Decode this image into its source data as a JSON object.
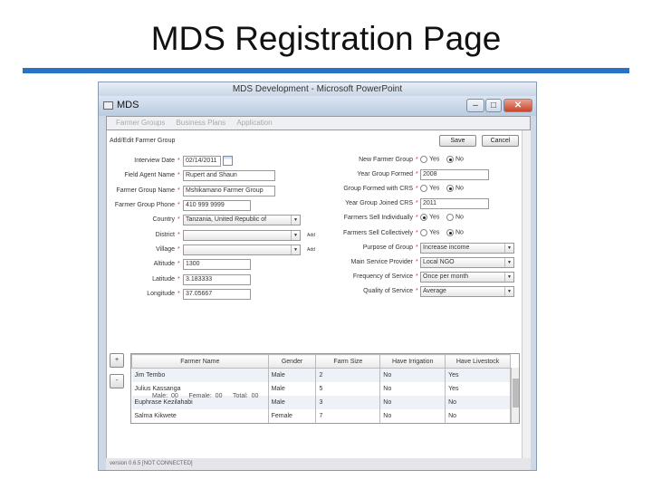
{
  "slide_title": "MDS Registration Page",
  "ppt_title": "MDS Development - Microsoft PowerPoint",
  "app": {
    "title": "MDS",
    "menu": [
      "Farmer Groups",
      "Business Plans",
      "Application"
    ],
    "section": "Add/Edit Farmer Group",
    "save": "Save",
    "cancel": "Cancel",
    "status": "version 0.6.5 [NOT CONNECTED]"
  },
  "left_fields": [
    {
      "label": "Interview Date",
      "value": "02/14/2011",
      "type": "date"
    },
    {
      "label": "Field Agent Name",
      "value": "Rupert and Shaun",
      "type": "text"
    },
    {
      "label": "Farmer Group Name",
      "value": "Mshikamano Farmer Group",
      "type": "text"
    },
    {
      "label": "Farmer Group Phone",
      "value": "410 999 9999",
      "type": "short"
    },
    {
      "label": "Country",
      "value": "Tanzania, United Republic of",
      "type": "select"
    },
    {
      "label": "District",
      "value": "",
      "type": "select",
      "add": "Add"
    },
    {
      "label": "Village",
      "value": "",
      "type": "select",
      "add": "Add"
    },
    {
      "label": "Altitude",
      "value": "1300",
      "type": "short"
    },
    {
      "label": "Latitude",
      "value": "3.183333",
      "type": "short"
    },
    {
      "label": "Longitude",
      "value": "37.05667",
      "type": "short"
    }
  ],
  "right_fields": [
    {
      "label": "New Farmer Group",
      "type": "radio",
      "selected": "No"
    },
    {
      "label": "Year Group Formed",
      "type": "text",
      "value": "2008"
    },
    {
      "label": "Group Formed with CRS",
      "type": "radio",
      "selected": "No"
    },
    {
      "label": "Year Group Joined CRS",
      "type": "text",
      "value": "2011"
    },
    {
      "label": "Farmers Sell Individually",
      "type": "radio",
      "selected": "Yes"
    },
    {
      "label": "Farmers Sell Collectively",
      "type": "radio",
      "selected": "No"
    },
    {
      "label": "Purpose of Group",
      "type": "select",
      "value": "Increase income"
    },
    {
      "label": "Main Service Provider",
      "type": "select",
      "value": "Local NGO"
    },
    {
      "label": "Frequency of Service",
      "type": "select",
      "value": "Once per month"
    },
    {
      "label": "Quality of Service",
      "type": "select",
      "value": "Average"
    }
  ],
  "radio_labels": {
    "yes": "Yes",
    "no": "No"
  },
  "table": {
    "add": "+",
    "remove": "-",
    "columns": [
      "Farmer Name",
      "Gender",
      "Farm Size",
      "Have Irrigation",
      "Have Livestock"
    ],
    "rows": [
      [
        "Jim Tembo",
        "Male",
        "2",
        "No",
        "Yes"
      ],
      [
        "Julius Kassanga",
        "Male",
        "5",
        "No",
        "Yes"
      ],
      [
        "Euphrase Kezilahabi",
        "Male",
        "3",
        "No",
        "No"
      ],
      [
        "Salma Kikwete",
        "Female",
        "7",
        "No",
        "No"
      ]
    ]
  },
  "summary": {
    "male_label": "Male:",
    "male": "00",
    "female_label": "Female:",
    "female": "00",
    "total_label": "Total:",
    "total": "00"
  }
}
